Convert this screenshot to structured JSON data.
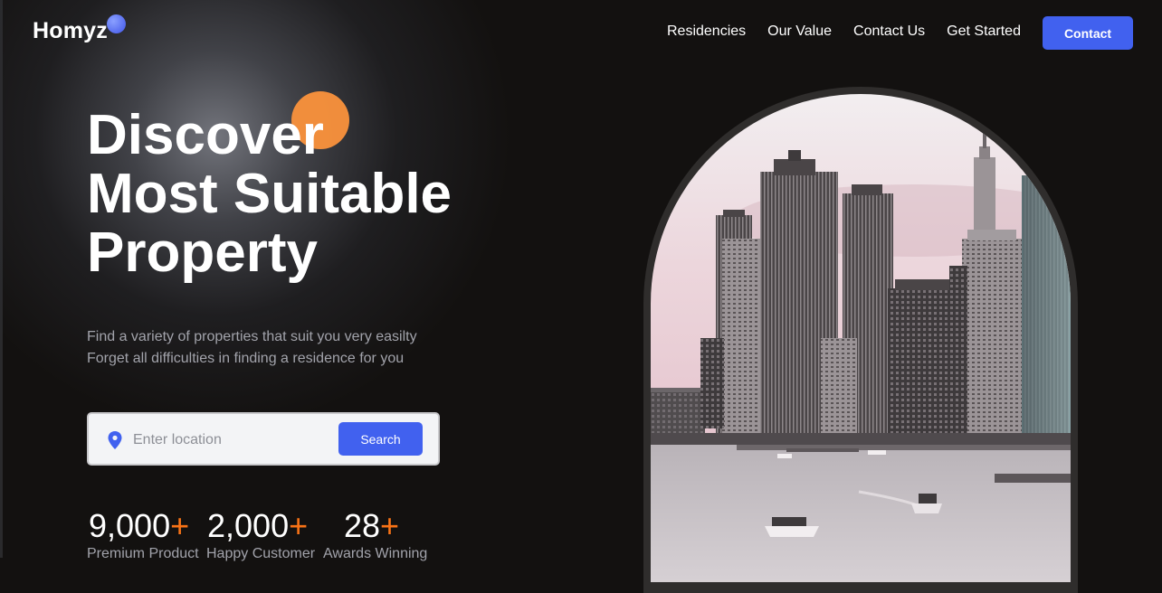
{
  "header": {
    "logo": "Homyz",
    "nav": [
      "Residencies",
      "Our Value",
      "Contact Us",
      "Get Started"
    ],
    "contact_label": "Contact"
  },
  "hero": {
    "title_lines": [
      "Discover",
      "Most Suitable",
      "Property"
    ],
    "subtitle_lines": [
      "Find a variety of properties that suit you very easilty",
      "Forget all difficulties in finding a residence for you"
    ]
  },
  "search": {
    "placeholder": "Enter location",
    "value": "",
    "button_label": "Search",
    "icon": "location-pin-icon"
  },
  "stats": [
    {
      "value": "9,000",
      "suffix": "+",
      "label": "Premium Product"
    },
    {
      "value": "2,000",
      "suffix": "+",
      "label": "Happy Customer"
    },
    {
      "value": "28",
      "suffix": "+",
      "label": "Awards Winning"
    }
  ],
  "colors": {
    "background": "#131110",
    "accent_blue": "#4161ef",
    "accent_orange": "#f97316",
    "circle_orange": "#fb923c"
  }
}
